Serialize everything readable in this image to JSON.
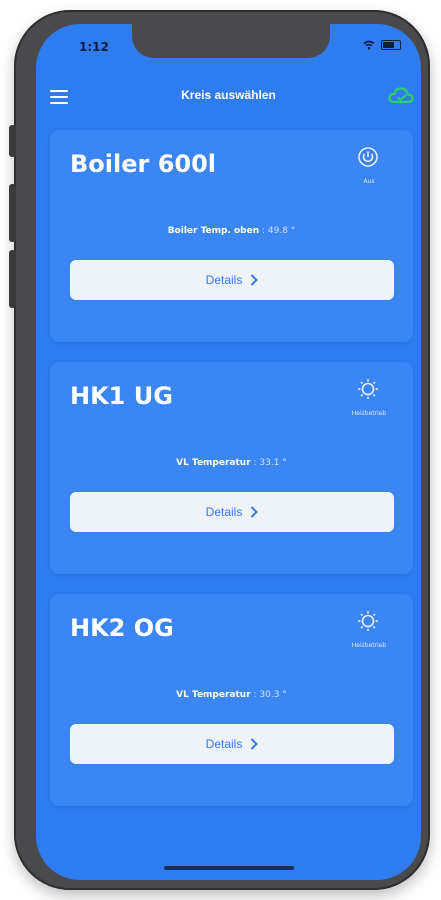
{
  "status": {
    "time": "1:12"
  },
  "header": {
    "title": "Kreis auswählen"
  },
  "colors": {
    "screen": "#2f7bf0",
    "card": "#3a86f4",
    "cloud": "#2dcf6b",
    "button": "#eef2f9"
  },
  "cards": [
    {
      "title": "Boiler 600l",
      "mode_label": "Aus",
      "reading_label": "Boiler Temp. oben",
      "reading_value": ": 49.8 °",
      "button": "Details"
    },
    {
      "title": "HK1 UG",
      "mode_label": "Heizbetrieb",
      "reading_label": "VL Temperatur",
      "reading_value": ": 33.1 °",
      "button": "Details"
    },
    {
      "title": "HK2 OG",
      "mode_label": "Heizbetrieb",
      "reading_label": "VL Temperatur",
      "reading_value": ": 30.3 °",
      "button": "Details"
    }
  ]
}
